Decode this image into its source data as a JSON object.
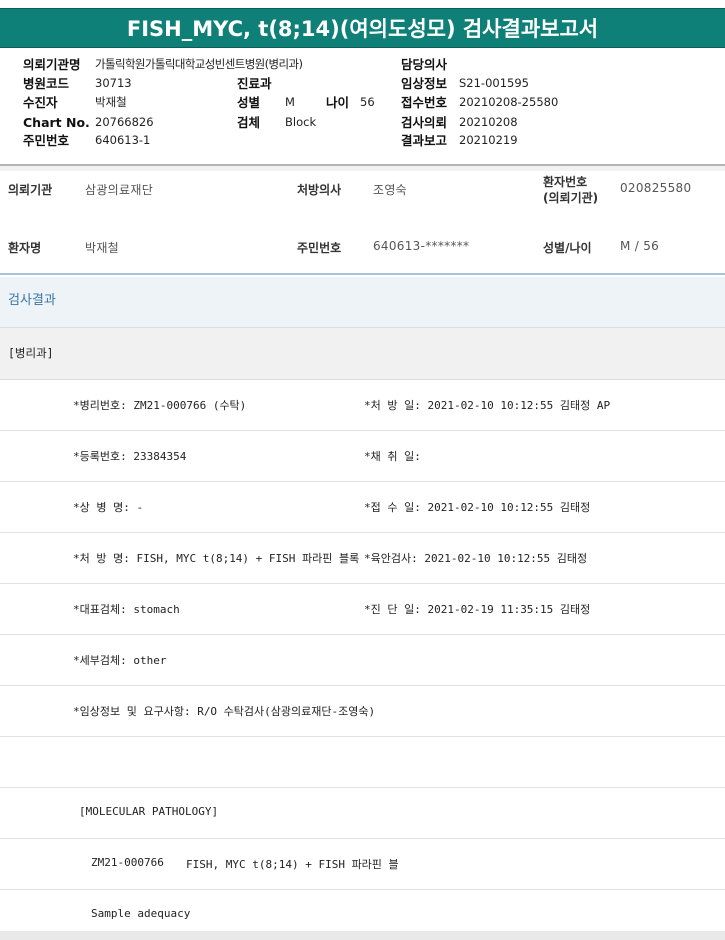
{
  "title": "FISH_MYC, t(8;14)(여의도성모) 검사결과보고서",
  "header": {
    "request_org": {
      "label": "의뢰기관명",
      "value": "가톨릭학원가톨릭대학교성빈센트병원(병리과)"
    },
    "hospital_code": {
      "label": "병원코드",
      "value": "30713"
    },
    "collector": {
      "label": "수진자",
      "value": "박재철"
    },
    "chart_no": {
      "label": "Chart No.",
      "value": "20766826"
    },
    "resident_no": {
      "label": "주민번호",
      "value": "640613-1"
    },
    "dept": {
      "label": "진료과",
      "value": ""
    },
    "sex": {
      "label": "성별",
      "value": "M"
    },
    "age": {
      "label": "나이",
      "value": "56"
    },
    "specimen": {
      "label": "검체",
      "value": "Block"
    },
    "doctor": {
      "label": "담당의사",
      "value": ""
    },
    "clinical_info": {
      "label": "임상정보",
      "value": "S21-001595"
    },
    "receipt_no": {
      "label": "접수번호",
      "value": "20210208-25580"
    },
    "test_request": {
      "label": "검사의뢰",
      "value": "20210208"
    },
    "result_report": {
      "label": "결과보고",
      "value": "20210219"
    }
  },
  "info": {
    "org": {
      "label": "의뢰기관",
      "value": "삼광의료재단"
    },
    "prescriber": {
      "label": "처방의사",
      "value": "조영숙"
    },
    "patient_no_label_1": "환자번호",
    "patient_no_label_2": "(의뢰기관)",
    "patient_no": "020825580",
    "patient_name": {
      "label": "환자명",
      "value": "박재철"
    },
    "resident_no": {
      "label": "주민번호",
      "value": "640613-*******"
    },
    "sex_age": {
      "label": "성별/나이",
      "value": "M / 56"
    }
  },
  "section_title": "검사결과",
  "department": "[병리과]",
  "rows": [
    {
      "left": "*병리번호: ZM21-000766 (수탁)",
      "right": "*처 방 일: 2021-02-10 10:12:55  김태정 AP"
    },
    {
      "left": "*등록번호: 23384354",
      "right": "*채 취 일:"
    },
    {
      "left": "*상 병 명: -",
      "right": "*접 수 일: 2021-02-10 10:12:55  김태정"
    },
    {
      "left": "*처 방 명: FISH, MYC t(8;14) + FISH 파라핀 블록",
      "right": "*육안검사: 2021-02-10 10:12:55  김태정"
    },
    {
      "left": "*대표검체: stomach",
      "right": "*진 단 일: 2021-02-19 11:35:15  김태정"
    },
    {
      "left": "*세부검체: other",
      "right": ""
    },
    {
      "left": "*임상정보 및 요구사항: R/O 수탁검사(삼광의료재단-조영숙)",
      "right": ""
    }
  ],
  "molecular_heading": "[MOLECULAR PATHOLOGY]",
  "molecular_id": "ZM21-000766",
  "molecular_test": "FISH, MYC t(8;14) + FISH 파라핀 블",
  "sample_adequacy": "Sample adequacy"
}
